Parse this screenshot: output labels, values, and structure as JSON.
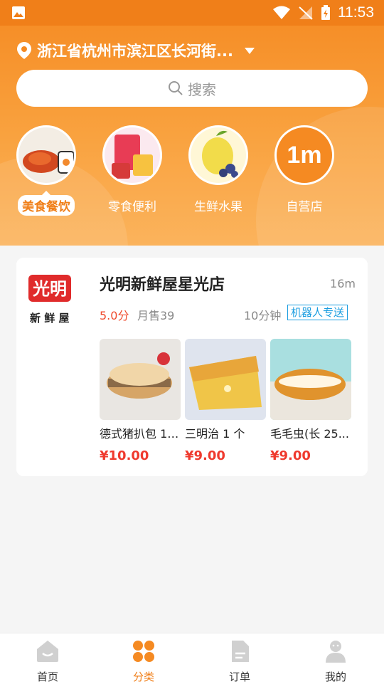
{
  "status_bar": {
    "time": "11:53"
  },
  "header": {
    "location": "浙江省杭州市滨江区长河街...",
    "search_placeholder": "搜索"
  },
  "categories": [
    {
      "label": "美食餐饮",
      "active": true
    },
    {
      "label": "零食便利",
      "active": false
    },
    {
      "label": "生鲜水果",
      "active": false
    },
    {
      "label": "自营店",
      "active": false,
      "logo_text": "1m"
    }
  ],
  "shop": {
    "name": "光明新鲜屋星光店",
    "distance": "16m",
    "score": "5.0分",
    "sales": "月售39",
    "delivery_time": "10分钟",
    "delivery_tag": "机器人专送",
    "logo_text_top": "光明",
    "logo_text_bottom": "新 鲜 屋",
    "products": [
      {
        "name": "德式猪扒包 1 ...",
        "price": "¥10.00"
      },
      {
        "name": "三明治 1 个",
        "price": "¥9.00"
      },
      {
        "name": "毛毛虫(长 25...",
        "price": "¥9.00"
      }
    ]
  },
  "tabbar": [
    {
      "label": "首页",
      "active": false
    },
    {
      "label": "分类",
      "active": true
    },
    {
      "label": "订单",
      "active": false
    },
    {
      "label": "我的",
      "active": false
    }
  ],
  "colors": {
    "brand_orange": "#f07f19",
    "price_red": "#ef3a2e",
    "tag_blue": "#1a9de0"
  }
}
